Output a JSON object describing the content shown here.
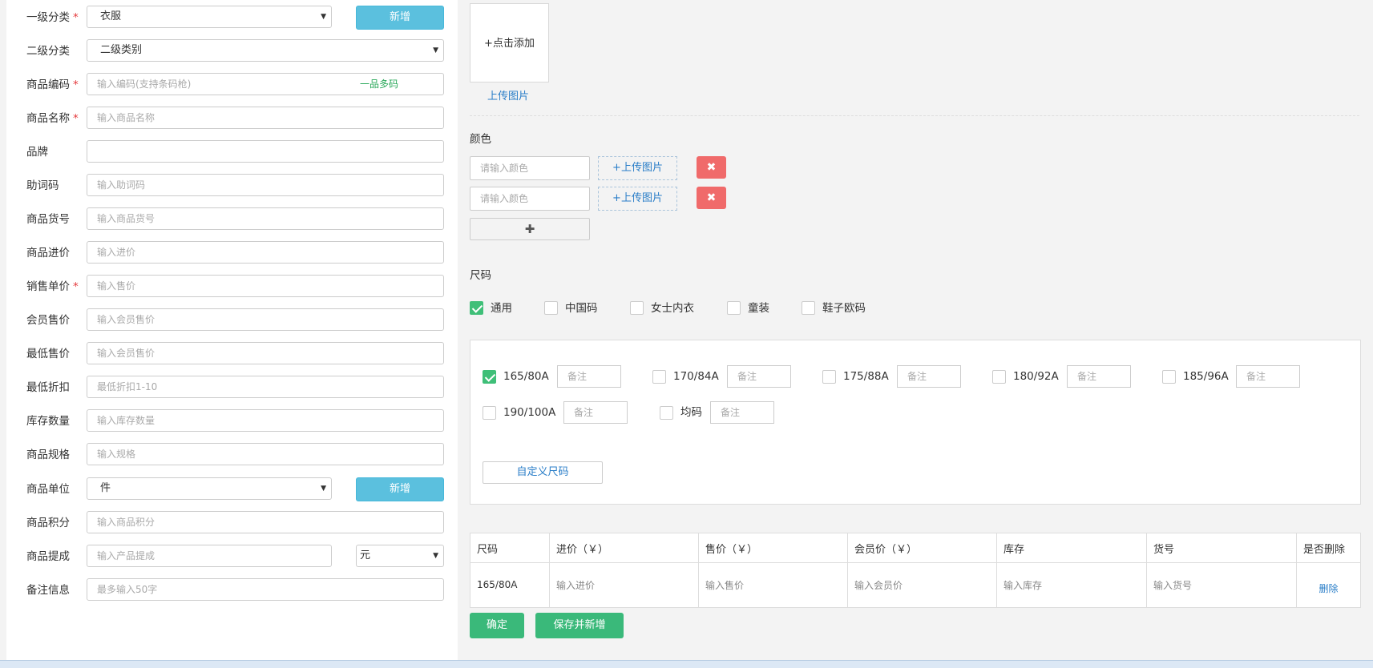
{
  "form": {
    "category1": {
      "label": "一级分类",
      "value": "衣服",
      "new_button": "新增"
    },
    "category2": {
      "label": "二级分类",
      "value": "二级类别"
    },
    "code": {
      "label": "商品编码",
      "placeholder": "输入编码(支持条码枪)",
      "multi_code": "一品多码"
    },
    "name": {
      "label": "商品名称",
      "placeholder": "输入商品名称"
    },
    "brand": {
      "label": "品牌",
      "placeholder": ""
    },
    "mnemonic": {
      "label": "助词码",
      "placeholder": "输入助词码"
    },
    "item_no": {
      "label": "商品货号",
      "placeholder": "输入商品货号"
    },
    "purchase_price": {
      "label": "商品进价",
      "placeholder": "输入进价"
    },
    "sale_price": {
      "label": "销售单价",
      "placeholder": "输入售价"
    },
    "member_price": {
      "label": "会员售价",
      "placeholder": "输入会员售价"
    },
    "min_price": {
      "label": "最低售价",
      "placeholder": "输入会员售价"
    },
    "min_discount": {
      "label": "最低折扣",
      "placeholder": "最低折扣1-10"
    },
    "stock": {
      "label": "库存数量",
      "placeholder": "输入库存数量"
    },
    "spec": {
      "label": "商品规格",
      "placeholder": "输入规格"
    },
    "unit": {
      "label": "商品单位",
      "value": "件",
      "new_button": "新增"
    },
    "points": {
      "label": "商品积分",
      "placeholder": "输入商品积分"
    },
    "commission": {
      "label": "商品提成",
      "placeholder": "输入产品提成",
      "unit_value": "元"
    },
    "remark": {
      "label": "备注信息",
      "placeholder": "最多输入50字"
    }
  },
  "upload": {
    "add_text": "+点击添加",
    "link": "上传图片"
  },
  "color": {
    "title": "颜色",
    "rows": [
      {
        "placeholder": "请输入颜色",
        "upload": "+上传图片",
        "delete": "✖"
      },
      {
        "placeholder": "请输入颜色",
        "upload": "+上传图片",
        "delete": "✖"
      }
    ],
    "add": "✚"
  },
  "size": {
    "title": "尺码",
    "tabs": [
      {
        "label": "通用",
        "checked": true
      },
      {
        "label": "中国码",
        "checked": false
      },
      {
        "label": "女士内衣",
        "checked": false
      },
      {
        "label": "童装",
        "checked": false
      },
      {
        "label": "鞋子欧码",
        "checked": false
      }
    ],
    "options": [
      {
        "label": "165/80A",
        "checked": true
      },
      {
        "label": "170/84A",
        "checked": false
      },
      {
        "label": "175/88A",
        "checked": false
      },
      {
        "label": "180/92A",
        "checked": false
      },
      {
        "label": "185/96A",
        "checked": false
      },
      {
        "label": "190/100A",
        "checked": false
      },
      {
        "label": "均码",
        "checked": false
      }
    ],
    "note_placeholder": "备注",
    "custom_button": "自定义尺码"
  },
  "table": {
    "headers": [
      "尺码",
      "进价（￥）",
      "售价（￥）",
      "会员价（￥）",
      "库存",
      "货号",
      "是否删除"
    ],
    "rows": [
      {
        "size": "165/80A",
        "purchase": "输入进价",
        "sale": "输入售价",
        "member": "输入会员价",
        "stock": "输入库存",
        "item_no": "输入货号",
        "delete": "删除"
      }
    ]
  },
  "buttons": {
    "confirm": "确定",
    "save_new": "保存并新增"
  }
}
